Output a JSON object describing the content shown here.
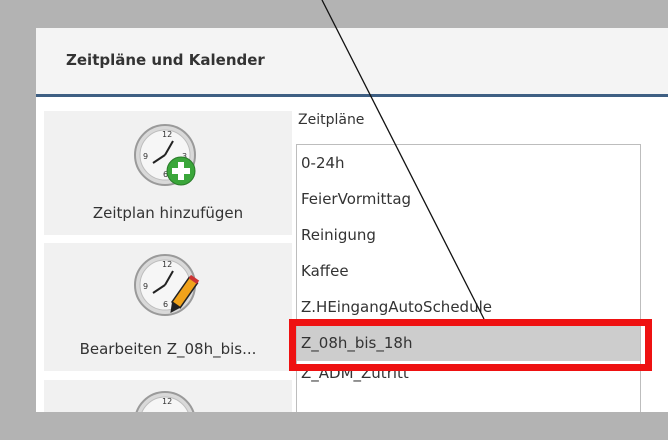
{
  "panel": {
    "title": "Zeitpläne und Kalender"
  },
  "sidebar": {
    "items": [
      {
        "label": "Zeitplan hinzufügen",
        "icon": "clock-add-icon"
      },
      {
        "label": "Bearbeiten Z_08h_bis...",
        "icon": "clock-edit-icon"
      },
      {
        "label": "",
        "icon": "clock-icon"
      }
    ]
  },
  "schedules": {
    "label": "Zeitpläne",
    "items": [
      {
        "name": "0-24h",
        "selected": false
      },
      {
        "name": "FeierVormittag",
        "selected": false
      },
      {
        "name": "Reinigung",
        "selected": false
      },
      {
        "name": "Kaffee",
        "selected": false
      },
      {
        "name": "Z.HEingangAutoSchedule",
        "selected": false
      },
      {
        "name": "Z_08h_bis_18h",
        "selected": true
      },
      {
        "name": "Z_ADM_Zutritt",
        "selected": false
      }
    ]
  },
  "annotation": {
    "highlight_color": "#ee1111",
    "arrow_color": "#111111"
  },
  "colors": {
    "background": "#b3b3b3",
    "header_rule": "#3e5f83",
    "selected_row": "#cdcdcd"
  }
}
